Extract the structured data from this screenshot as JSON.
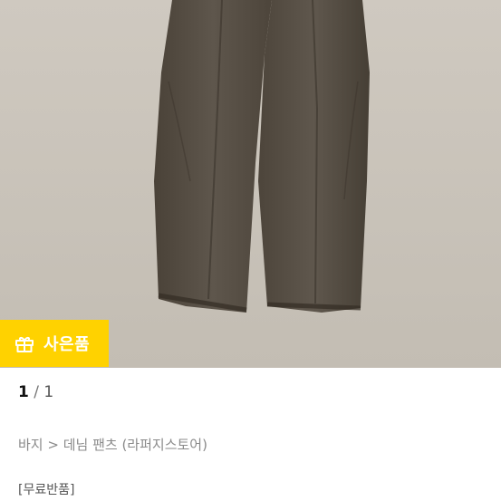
{
  "product": {
    "image_alt": "바지 product photo"
  },
  "badge": {
    "label": "사은품",
    "icon": "gift-icon",
    "color": "#ffd200"
  },
  "pager": {
    "current": "1",
    "separator": " / ",
    "total": "1"
  },
  "breadcrumb": {
    "text": "바지 > 데님 팬츠 (라퍼지스토어)"
  },
  "tag": {
    "text": "[무료반품]"
  }
}
